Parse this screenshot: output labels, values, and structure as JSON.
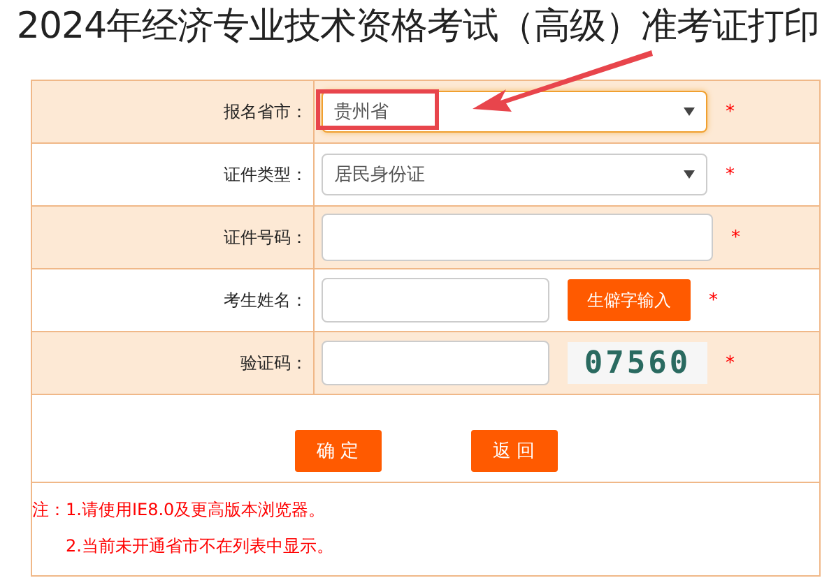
{
  "title": "2024年经济专业技术资格考试（高级）准考证打印",
  "rows": [
    {
      "kind": "select",
      "label": "报名省市：",
      "value": "贵州省",
      "focused": true,
      "required": "*",
      "highlighted": true
    },
    {
      "kind": "select",
      "label": "证件类型：",
      "value": "居民身份证",
      "focused": false,
      "required": "*"
    },
    {
      "kind": "input",
      "label": "证件号码：",
      "required": "*"
    },
    {
      "kind": "name",
      "label": "考生姓名：",
      "button": "生僻字输入",
      "required": "*"
    },
    {
      "kind": "captcha",
      "label": "验证码：",
      "captcha": "07560",
      "required": "*"
    }
  ],
  "buttons": [
    "确 定",
    "返 回"
  ],
  "notes": [
    "注：1.请使用IE8.0及更高版本浏览器。",
    "2.当前未开通省市不在列表中显示。"
  ]
}
